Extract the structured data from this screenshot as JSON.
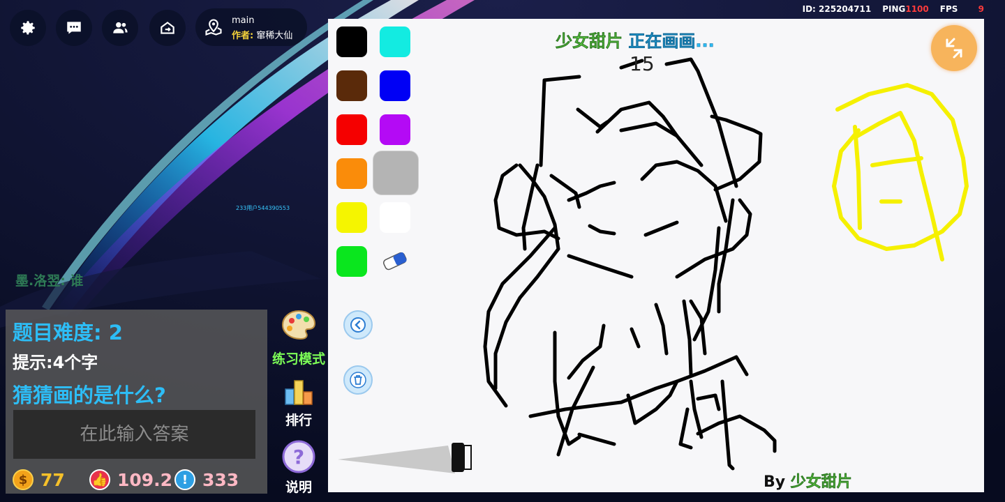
{
  "top_bar": {
    "icons": [
      "gear-icon",
      "chat-icon",
      "people-icon",
      "room-switch-icon"
    ],
    "map_name": "main",
    "author_label": "作者:",
    "author_name": "窜稀大仙"
  },
  "status": {
    "id_label": "ID:",
    "id_value": "225204711",
    "ping_label": "PING",
    "ping_value": "1100",
    "fps_label": "FPS",
    "fps_value": "9"
  },
  "world": {
    "user_tag": "233用户544390553",
    "chat_line": "墨.洛翌: 谁"
  },
  "quiz": {
    "difficulty": "题目难度: 2",
    "hint": "提示:4个字",
    "question": "猜猜画的是什么?",
    "answer_placeholder": "在此输入答案",
    "coins": "77",
    "likes": "109.2",
    "warnings": "333"
  },
  "side_buttons": {
    "practice": "练习模式",
    "rank": "排行",
    "help": "说明"
  },
  "canvas": {
    "drawer_name": "少女甜片",
    "drawer_status": "正在画画...",
    "timer": "15",
    "by_label": "By",
    "by_name": "少女甜片",
    "colors": [
      "#000000",
      "#13ebe1",
      "#5a2a0a",
      "#0000f5",
      "#f50000",
      "#b40af5",
      "#fa8c0a",
      "#b4b4b4",
      "#f5f500",
      "#ffffff",
      "#0ae61e"
    ],
    "selected_color": "#b4b4b4",
    "brush_size_percent": 100
  }
}
